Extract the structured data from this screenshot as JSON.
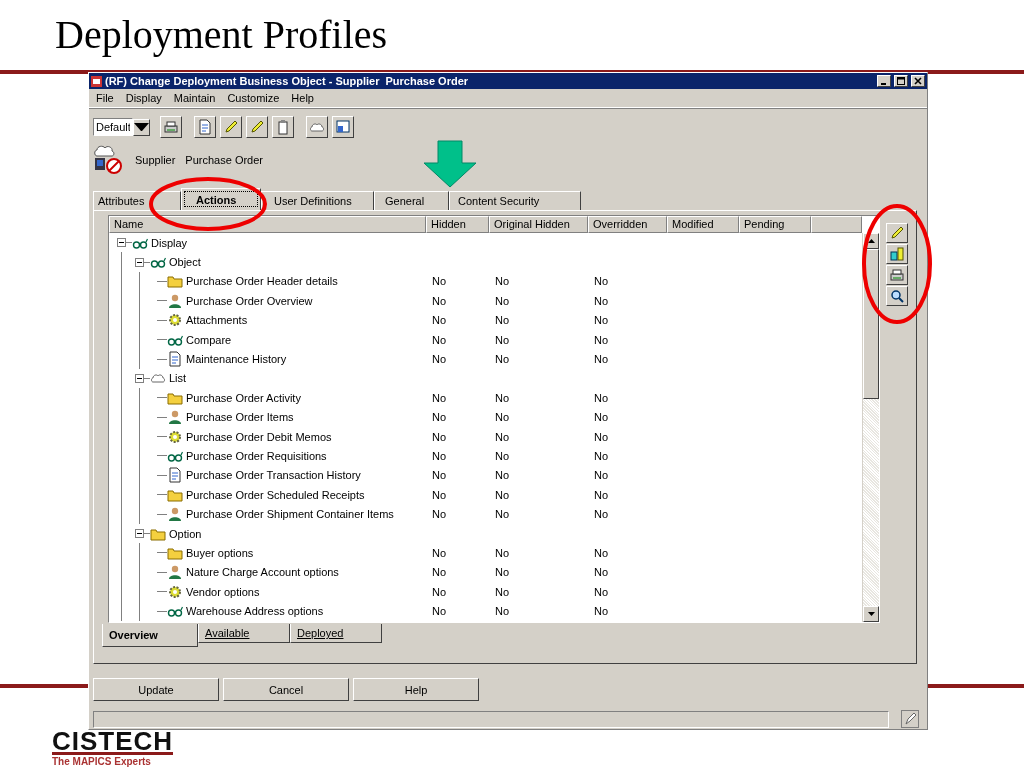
{
  "slide": {
    "title": "Deployment Profiles",
    "logo": {
      "wordmark": "CISTECH",
      "tagline": "The MAPICS Experts"
    }
  },
  "window": {
    "title": "(RF) Change Deployment Business Object - Supplier  Purchase Order"
  },
  "menu": [
    "File",
    "Display",
    "Maintain",
    "Customize",
    "Help"
  ],
  "toolbar": {
    "view_select": {
      "value": "Default"
    }
  },
  "header": {
    "texts": [
      "Supplier",
      "Purchase Order"
    ]
  },
  "tabs": [
    {
      "label": "Attributes",
      "selected": false
    },
    {
      "label": "Actions",
      "selected": true
    },
    {
      "label": "User Definitions",
      "selected": false
    },
    {
      "label": "General",
      "selected": false
    },
    {
      "label": "Content Security",
      "selected": false
    }
  ],
  "table": {
    "columns": [
      "Name",
      "Hidden",
      "Original Hidden",
      "Overridden",
      "Modified",
      "Pending"
    ],
    "tree": [
      {
        "kind": "group",
        "label": "Display",
        "expanded": true,
        "children": [
          {
            "kind": "group",
            "label": "Object",
            "expanded": true,
            "children": [
              {
                "kind": "leaf",
                "label": "Purchase Order Header details",
                "values": [
                  "No",
                  "No",
                  "No"
                ]
              },
              {
                "kind": "leaf",
                "label": "Purchase Order Overview",
                "values": [
                  "No",
                  "No",
                  "No"
                ]
              },
              {
                "kind": "leaf",
                "label": "Attachments",
                "values": [
                  "No",
                  "No",
                  "No"
                ]
              },
              {
                "kind": "leaf",
                "label": "Compare",
                "values": [
                  "No",
                  "No",
                  "No"
                ]
              },
              {
                "kind": "leaf",
                "label": "Maintenance History",
                "values": [
                  "No",
                  "No",
                  "No"
                ]
              }
            ]
          },
          {
            "kind": "group",
            "label": "List",
            "expanded": true,
            "children": [
              {
                "kind": "leaf",
                "label": "Purchase Order Activity",
                "values": [
                  "No",
                  "No",
                  "No"
                ]
              },
              {
                "kind": "leaf",
                "label": "Purchase Order Items",
                "values": [
                  "No",
                  "No",
                  "No"
                ]
              },
              {
                "kind": "leaf",
                "label": "Purchase Order Debit Memos",
                "values": [
                  "No",
                  "No",
                  "No"
                ]
              },
              {
                "kind": "leaf",
                "label": "Purchase Order Requisitions",
                "values": [
                  "No",
                  "No",
                  "No"
                ]
              },
              {
                "kind": "leaf",
                "label": "Purchase Order Transaction History",
                "values": [
                  "No",
                  "No",
                  "No"
                ]
              },
              {
                "kind": "leaf",
                "label": "Purchase Order Scheduled Receipts",
                "values": [
                  "No",
                  "No",
                  "No"
                ]
              },
              {
                "kind": "leaf",
                "label": "Purchase Order Shipment Container Items",
                "values": [
                  "No",
                  "No",
                  "No"
                ]
              }
            ]
          },
          {
            "kind": "group",
            "label": "Option",
            "expanded": true,
            "children": [
              {
                "kind": "leaf",
                "label": "Buyer options",
                "values": [
                  "No",
                  "No",
                  "No"
                ]
              },
              {
                "kind": "leaf",
                "label": "Nature Charge Account options",
                "values": [
                  "No",
                  "No",
                  "No"
                ]
              },
              {
                "kind": "leaf",
                "label": "Vendor options",
                "values": [
                  "No",
                  "No",
                  "No"
                ]
              },
              {
                "kind": "leaf",
                "label": "Warehouse Address options",
                "values": [
                  "No",
                  "No",
                  "No"
                ]
              }
            ]
          }
        ]
      }
    ]
  },
  "view_tabs": [
    {
      "label": "Overview",
      "selected": true
    },
    {
      "label": "Available",
      "selected": false
    },
    {
      "label": "Deployed",
      "selected": false
    }
  ],
  "buttons": [
    "Update",
    "Cancel",
    "Help"
  ]
}
